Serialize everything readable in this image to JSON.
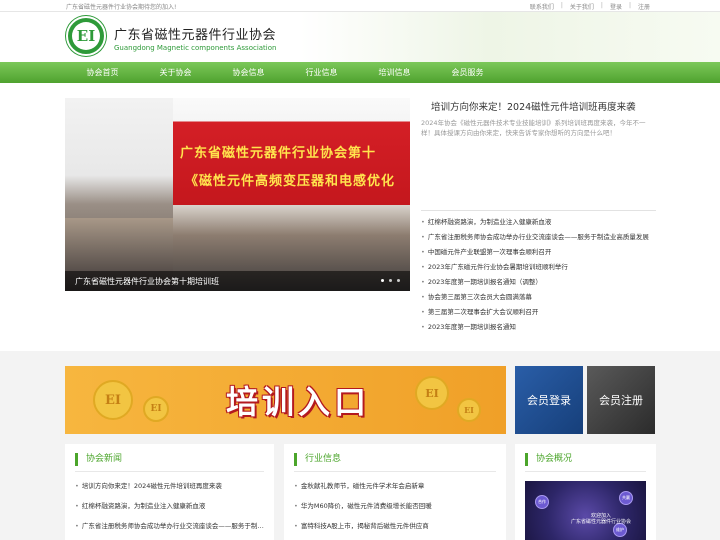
{
  "topbar": {
    "welcome": "广东省磁性元器件行业协会期待您的加入!",
    "links": [
      "联系我们",
      "关于我们",
      "登录",
      "注册"
    ]
  },
  "brand": {
    "logo_text": "EI",
    "name_cn": "广东省磁性元器件行业协会",
    "name_en": "Guangdong Magnetic components Association",
    "color": "#2e9a39"
  },
  "nav": [
    "协会首页",
    "关于协会",
    "协会信息",
    "行业信息",
    "培训信息",
    "会员服务"
  ],
  "slider": {
    "banner_line1": "广东省磁性元器件行业协会第十",
    "banner_line2": "《磁性元件高频变压器和电感优化",
    "caption": "广东省磁性元器件行业协会第十期培训班"
  },
  "feature": {
    "title": "培训方向你来定！2024磁性元件培训班再度来袭",
    "desc": "2024年协会《磁性元器件技术专业技能培训》系列培训班再度来袭，今年不一样！具体授课方向由你来定，快来告诉专家你想听的方向是什么吧！"
  },
  "news": [
    "红棉杯融资路演，为制造业注入健康新血液",
    "广东省注册税务师协会成功举办行业交流座谈会——服务于制造业高质量发展",
    "中国磁元件产业联盟第一次理事会顺利召开",
    "2023年广东磁元件行业协会暑期培训班顺利举行",
    "2023年度第一期培训报名通知（调整）",
    "协会第三届第三次会员大会圆满落幕",
    "第三届第二次理事会扩大会议顺利召开",
    "2023年度第一期培训报名通知"
  ],
  "promo": {
    "title": "培训入口",
    "coin_text": "EI"
  },
  "member": {
    "login": "会员登录",
    "register": "会员注册"
  },
  "sections": {
    "assoc_news": {
      "title": "协会新闻",
      "items": [
        "培训方向你来定！2024磁性元件培训班再度来袭",
        "红棉杯融资路演，为制造业注入健康新血液",
        "广东省注册税务师协会成功举办行业交流座谈会——服务于制造业高质量发展"
      ]
    },
    "industry_news": {
      "title": "行业信息",
      "items": [
        "金秋献礼教师节，磁性元件学术年会启新章",
        "华为M60降价，磁性元件消费级增长能否回暖",
        "富特科技A股上市，揭秘背后磁性元件供应商"
      ]
    },
    "about": {
      "title": "协会概况",
      "welcome_line1": "欢迎加入",
      "welcome_line2": "广东省磁性元器件行业协会",
      "circles": [
        "合作",
        "共赢",
        "维护"
      ]
    }
  }
}
